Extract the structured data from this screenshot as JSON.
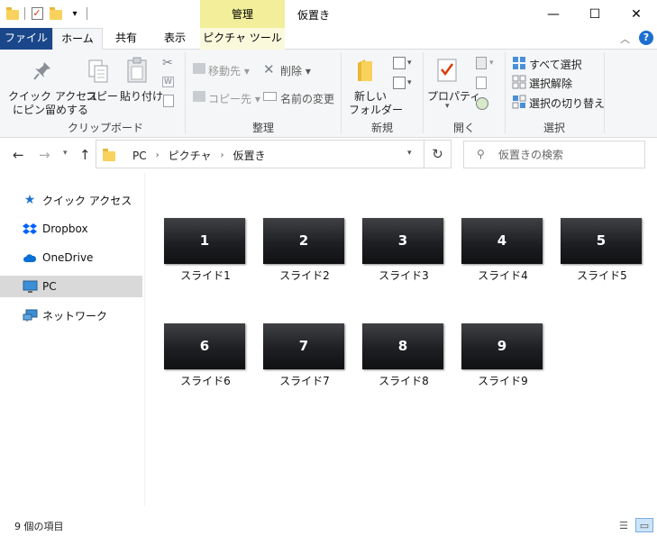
{
  "window": {
    "title": "仮置き",
    "context_tab_group": "管理",
    "buttons": {
      "minimize": "—",
      "maximize": "☐",
      "close": "✕"
    }
  },
  "ribbon_tabs": [
    "ファイル",
    "ホーム",
    "共有",
    "表示",
    "ピクチャ ツール"
  ],
  "ribbon": {
    "clipboard": {
      "pin_line1": "クイック アクセス",
      "pin_line2": "にピン留めする",
      "copy": "コピー",
      "paste": "貼り付け",
      "label": "クリップボード"
    },
    "organize": {
      "move_to": "移動先",
      "copy_to": "コピー先",
      "delete": "削除",
      "rename": "名前の変更",
      "label": "整理"
    },
    "new": {
      "new_folder_line1": "新しい",
      "new_folder_line2": "フォルダー",
      "label": "新規"
    },
    "open": {
      "properties": "プロパティ",
      "label": "開く"
    },
    "select": {
      "select_all": "すべて選択",
      "select_none": "選択解除",
      "invert": "選択の切り替え",
      "label": "選択"
    }
  },
  "address": {
    "crumbs": [
      "PC",
      "ピクチャ",
      "仮置き"
    ]
  },
  "search": {
    "placeholder": "仮置きの検索"
  },
  "sidebar": {
    "items": [
      {
        "label": "クイック アクセス",
        "icon": "star-icon"
      },
      {
        "label": "Dropbox",
        "icon": "dropbox-icon"
      },
      {
        "label": "OneDrive",
        "icon": "cloud-icon"
      },
      {
        "label": "PC",
        "icon": "computer-icon",
        "selected": true
      },
      {
        "label": "ネットワーク",
        "icon": "network-icon"
      }
    ]
  },
  "files": [
    {
      "thumb": "1",
      "name": "スライド1"
    },
    {
      "thumb": "2",
      "name": "スライド2"
    },
    {
      "thumb": "3",
      "name": "スライド3"
    },
    {
      "thumb": "4",
      "name": "スライド4"
    },
    {
      "thumb": "5",
      "name": "スライド5"
    },
    {
      "thumb": "6",
      "name": "スライド6"
    },
    {
      "thumb": "7",
      "name": "スライド7"
    },
    {
      "thumb": "8",
      "name": "スライド8"
    },
    {
      "thumb": "9",
      "name": "スライド9"
    }
  ],
  "status": {
    "count": "9 個の項目"
  },
  "colors": {
    "file_tab": "#19478a",
    "context_tab": "#f2ee9a",
    "selection": "#d9d9d9",
    "help": "#1c6fd0"
  }
}
